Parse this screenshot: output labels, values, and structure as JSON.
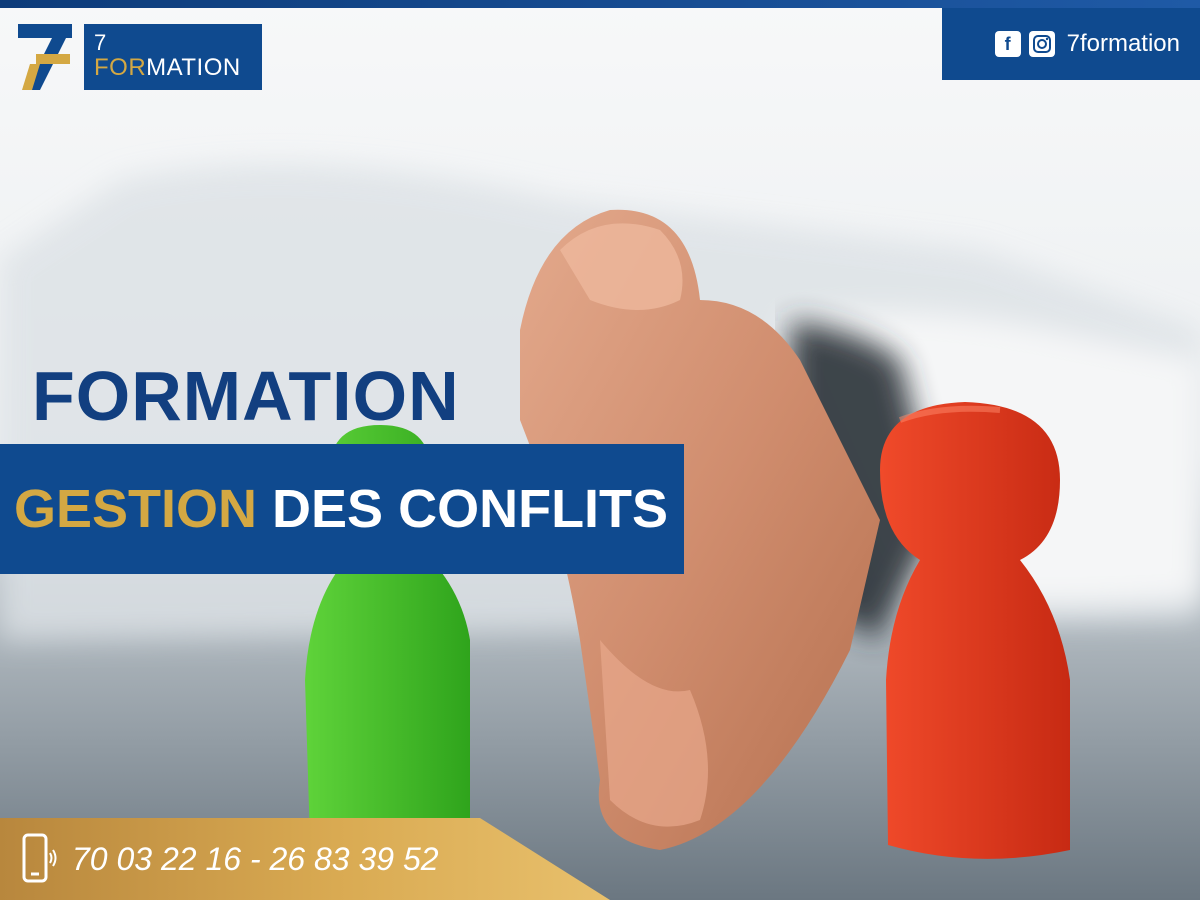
{
  "brand": {
    "logo_number": "7",
    "logo_text_gold": "FOR",
    "logo_text_white": "MATION",
    "colors": {
      "blue": "#0f4a8f",
      "gold": "#d4a843"
    }
  },
  "social": {
    "icons": [
      "facebook-icon",
      "instagram-icon"
    ],
    "handle": "7formation"
  },
  "hero": {
    "title": "FORMATION",
    "subtitle_gold": "GESTION",
    "subtitle_white": "DES CONFLITS"
  },
  "contact": {
    "icon": "phone-icon",
    "phones": "70 03 22 16  - 26 83 39 52"
  }
}
